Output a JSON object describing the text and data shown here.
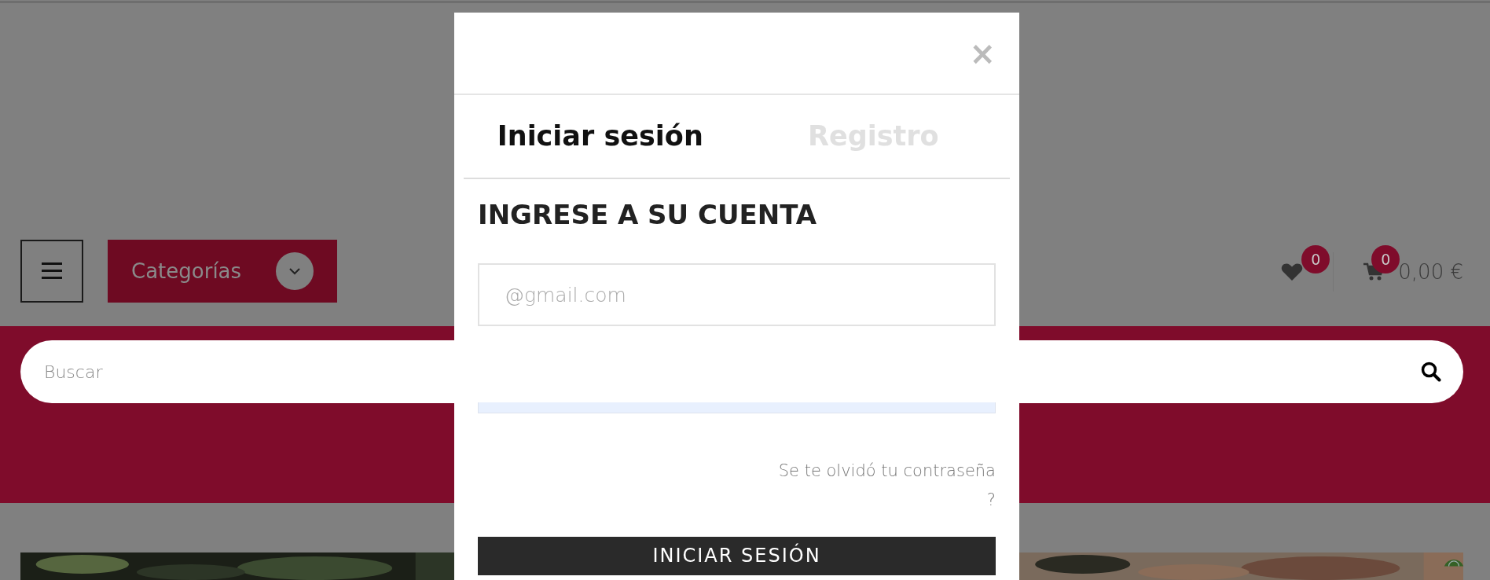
{
  "header": {
    "categories_button": {
      "label": "Categorías"
    },
    "wishlist": {
      "count": "0"
    },
    "cart": {
      "count": "0",
      "total": "0,00 €"
    }
  },
  "search": {
    "placeholder": "Buscar"
  },
  "modal": {
    "close": "×",
    "tabs": [
      {
        "label": "Iniciar sesión",
        "selected": true
      },
      {
        "label": "Registro",
        "selected": false
      }
    ],
    "heading": "INGRESE A SU CUENTA",
    "email": {
      "placeholder": "@gmail.com"
    },
    "forgot_link": "Se te olvidó tu contraseña ?",
    "submit": "INICIAR SESIÓN"
  }
}
